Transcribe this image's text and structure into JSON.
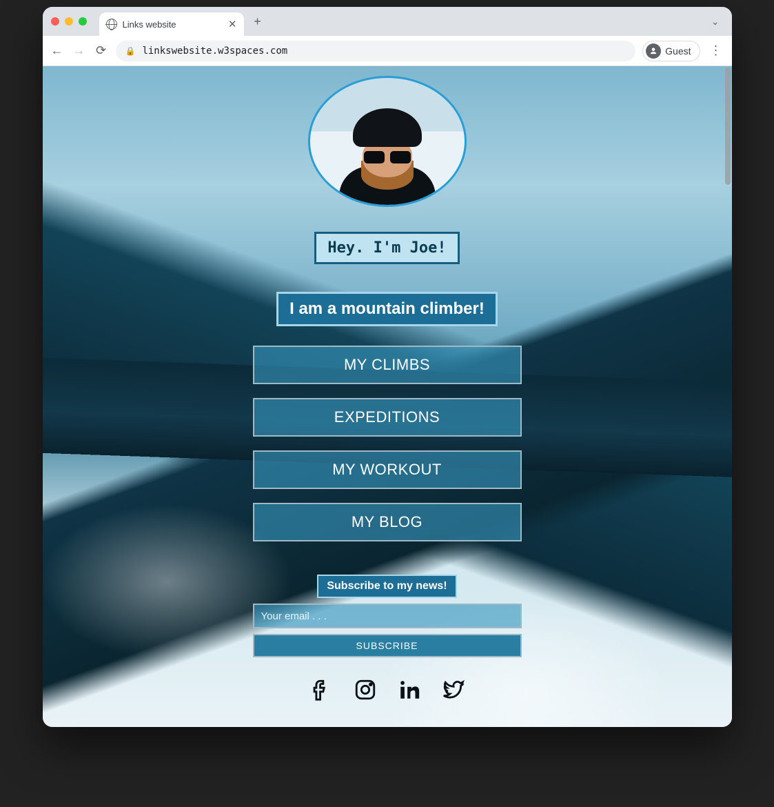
{
  "browser": {
    "tab_title": "Links website",
    "url": "linkswebsite.w3spaces.com",
    "guest_label": "Guest"
  },
  "hero": {
    "greeting": "Hey. I'm Joe!",
    "subtitle": "I am a mountain climber!"
  },
  "links": [
    {
      "label": "MY CLIMBS"
    },
    {
      "label": "EXPEDITIONS"
    },
    {
      "label": "MY WORKOUT"
    },
    {
      "label": "MY BLOG"
    }
  ],
  "subscribe": {
    "heading": "Subscribe to my news!",
    "placeholder": "Your email . . .",
    "button": "SUBSCRIBE"
  },
  "social": {
    "facebook": "facebook-icon",
    "instagram": "instagram-icon",
    "linkedin": "linkedin-icon",
    "twitter": "twitter-icon"
  }
}
